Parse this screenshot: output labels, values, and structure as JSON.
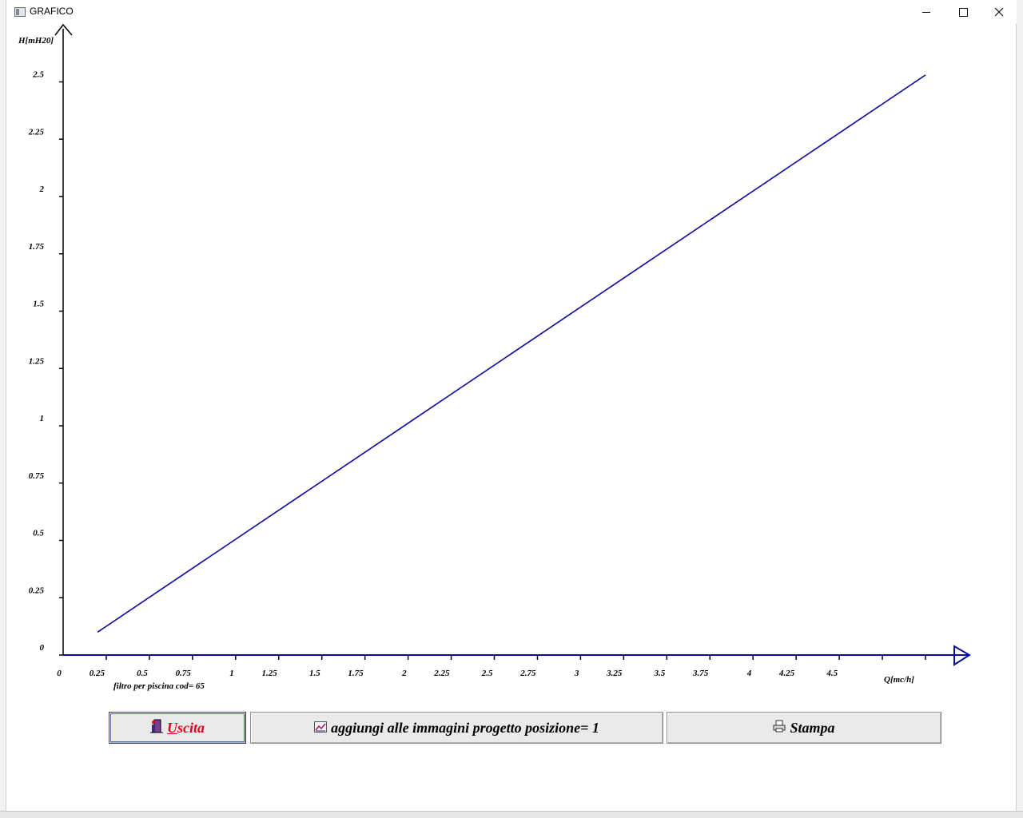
{
  "window": {
    "title": "GRAFICO"
  },
  "chart_data": {
    "type": "line",
    "ylabel": "H[mH20]",
    "xlabel": "Q[mc/h]",
    "caption": "filtro per piscina cod= 65",
    "xlim": [
      0,
      5
    ],
    "ylim": [
      0,
      2.5
    ],
    "yticks": [
      "0",
      "0.25",
      "0.5",
      "0.75",
      "1",
      "1.25",
      "1.5",
      "1.75",
      "2",
      "2.25",
      "2.5"
    ],
    "xticks": [
      "0",
      "0.25",
      "0.5",
      "0.75",
      "1",
      "1.25",
      "1.5",
      "1.75",
      "2",
      "2.25",
      "2.5",
      "2.75",
      "3",
      "3.25",
      "3.5",
      "3.75",
      "4",
      "4.25",
      "4.5"
    ],
    "series": [
      {
        "color": "#0a0aa0",
        "x": [
          0.2,
          5.0
        ],
        "y": [
          0.1,
          2.53
        ]
      }
    ]
  },
  "buttons": {
    "exit_underlined": "U",
    "exit_rest": "scita",
    "add": "aggiungi alle immagini progetto posizione= 1",
    "print": "Stampa"
  }
}
